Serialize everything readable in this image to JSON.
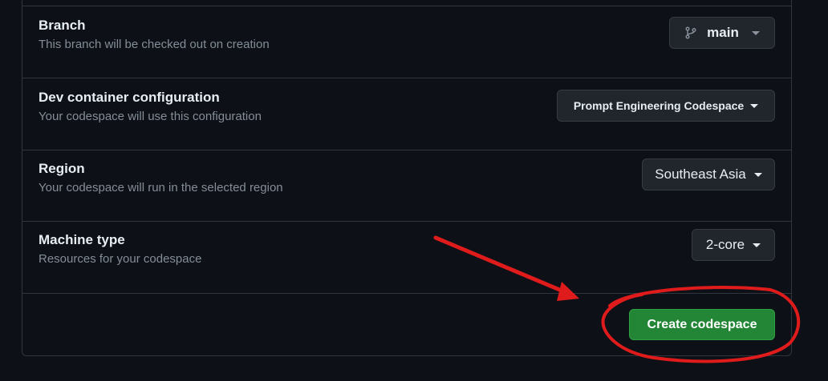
{
  "settings": {
    "branch": {
      "title": "Branch",
      "description": "This branch will be checked out on creation",
      "value": "main",
      "icon": "git-branch-icon"
    },
    "dev_container": {
      "title": "Dev container configuration",
      "description": "Your codespace will use this configuration",
      "value": "Prompt Engineering Codespace"
    },
    "region": {
      "title": "Region",
      "description": "Your codespace will run in the selected region",
      "value": "Southeast Asia"
    },
    "machine_type": {
      "title": "Machine type",
      "description": "Resources for your codespace",
      "value": "2-core"
    }
  },
  "actions": {
    "create_label": "Create codespace"
  },
  "colors": {
    "background": "#0d1117",
    "border": "#30363d",
    "button_bg": "#21262d",
    "primary_green": "#238636",
    "annotation_red": "#e01b1b"
  }
}
